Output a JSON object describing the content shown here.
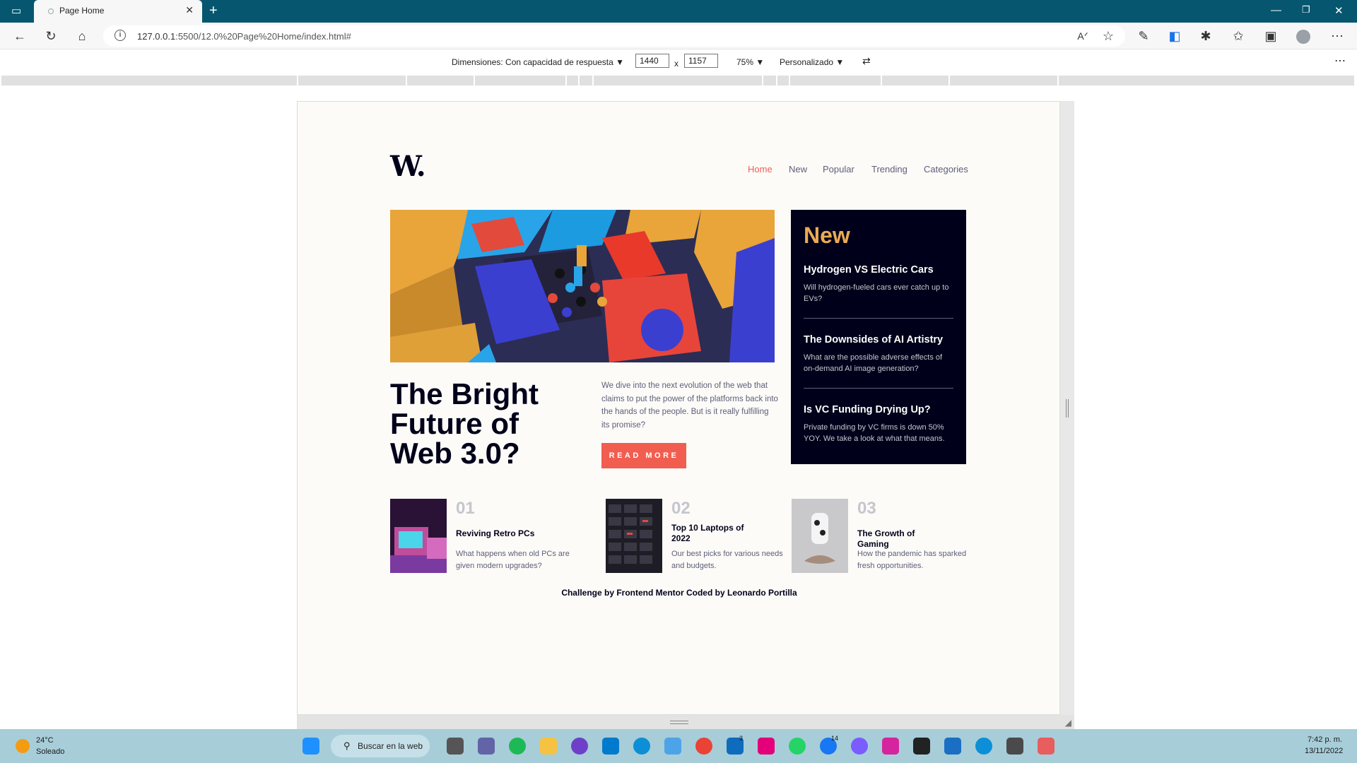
{
  "browser": {
    "tab_title": "Page Home",
    "tab_close": "✕",
    "new_tab": "+",
    "url_host": "127.0.0.1",
    "url_rest": ":5500/12.0%20Page%20Home/index.html#",
    "window_minimize": "—",
    "window_restore": "❐",
    "window_close": "✕"
  },
  "devtools": {
    "dimensions_label": "Dimensiones: Con capacidad de respuesta",
    "width": "1440",
    "times": "x",
    "height": "1157",
    "zoom": "75%",
    "throttle": "Personalizado",
    "more": "⋯"
  },
  "site": {
    "logo": "W.",
    "nav": [
      "Home",
      "New",
      "Popular",
      "Trending",
      "Categories"
    ],
    "hero": {
      "title": "The Bright Future of Web 3.0?",
      "description": "We dive into the next evolution of the web that claims to put the power of the platforms back into the hands of the people. But is it really fulfilling its promise?",
      "button": "READ MORE"
    },
    "new_section": {
      "heading": "New",
      "items": [
        {
          "title": "Hydrogen VS Electric Cars",
          "desc": "Will hydrogen-fueled cars ever catch up to EVs?"
        },
        {
          "title": "The Downsides of AI Artistry",
          "desc": "What are the possible adverse effects of on-demand AI image generation?"
        },
        {
          "title": "Is VC Funding Drying Up?",
          "desc": "Private funding by VC firms is down 50% YOY. We take a look at what that means."
        }
      ]
    },
    "cards": [
      {
        "num": "01",
        "title": "Reviving Retro PCs",
        "desc": "What happens when old PCs are given modern upgrades?"
      },
      {
        "num": "02",
        "title": "Top 10 Laptops of 2022",
        "desc": "Our best picks for various needs and budgets."
      },
      {
        "num": "03",
        "title": "The Growth of Gaming",
        "desc": "How the pandemic has sparked fresh opportunities."
      }
    ],
    "footer": "Challenge by Frontend Mentor Coded by Leonardo Portilla"
  },
  "taskbar": {
    "weather_temp": "24°C",
    "weather_desc": "Soleado",
    "search": "Buscar en la web",
    "mail_badge": "3",
    "facebook_badge": "14",
    "time": "7:42 p. m.",
    "date": "13/11/2022"
  },
  "colors": {
    "accent": "#f15e50",
    "dark": "#00001a",
    "new_heading": "#e9ab53",
    "title_bar": "#06566f",
    "taskbar": "#a7cdd9"
  }
}
